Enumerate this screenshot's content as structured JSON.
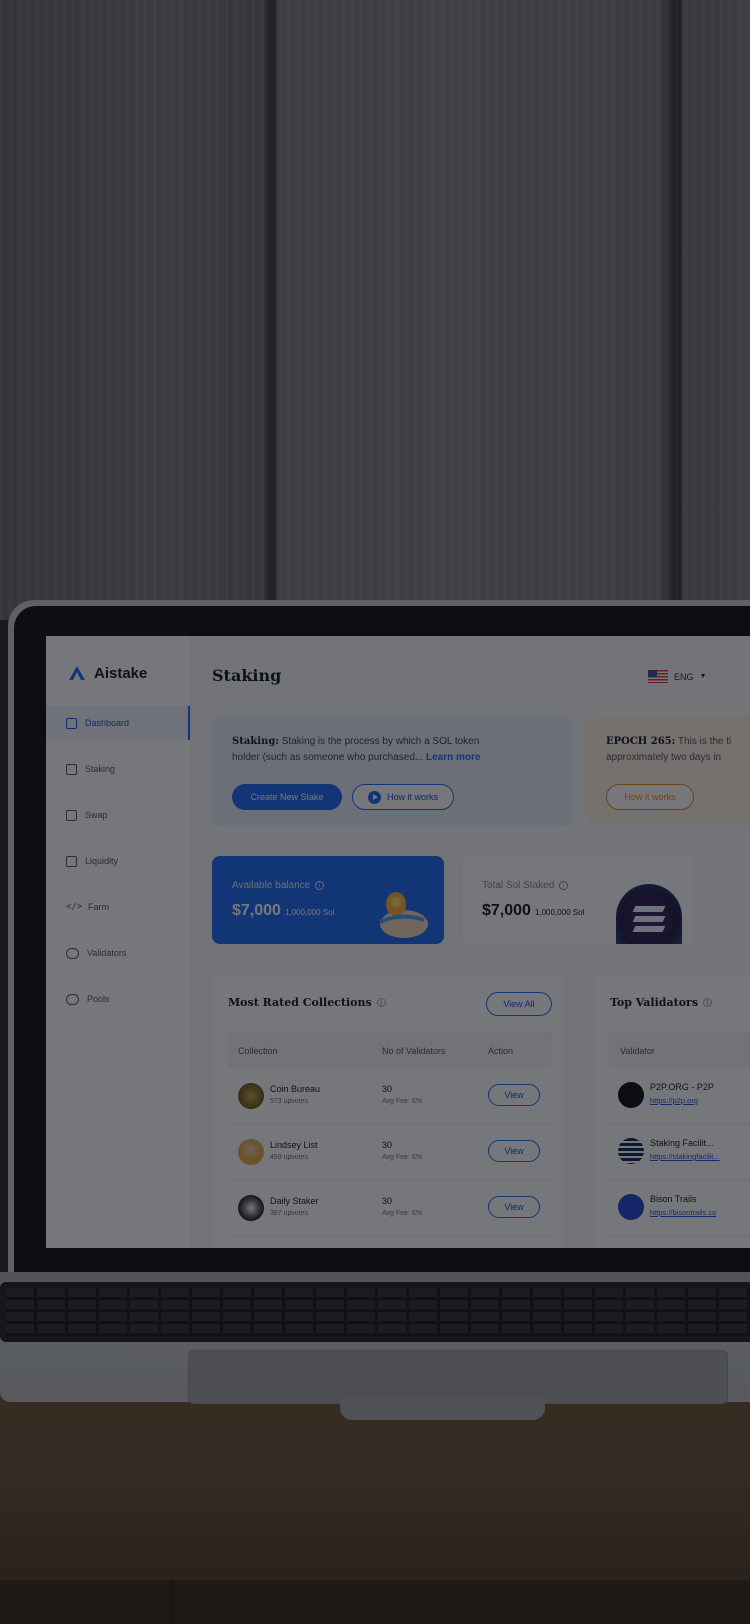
{
  "app": {
    "name": "Aistake"
  },
  "sidebar": {
    "items": [
      {
        "label": "Dashboard",
        "icon": "dashboard-icon",
        "active": true
      },
      {
        "label": "Staking",
        "icon": "staking-icon"
      },
      {
        "label": "Swap",
        "icon": "swap-icon"
      },
      {
        "label": "Liquidity",
        "icon": "card-icon"
      },
      {
        "label": "Farm",
        "icon": "code-icon"
      },
      {
        "label": "Validators",
        "icon": "validators-icon"
      },
      {
        "label": "Pools",
        "icon": "pools-icon"
      }
    ]
  },
  "header": {
    "title": "Staking",
    "language": "ENG"
  },
  "banner": {
    "lead": "Staking:",
    "text": "Staking is the process by which a SOL token holder (such as someone who purchased...",
    "link": "Learn more",
    "primary_button": "Create New Stake",
    "secondary_button": "How it works"
  },
  "epoch": {
    "lead": "EPOCH 265:",
    "line1": "This is the ti",
    "line2": "approximately two days in",
    "button": "How it works"
  },
  "cards": {
    "available": {
      "label": "Available balance",
      "value": "$7,000",
      "sub": "1,000,000 Sol"
    },
    "staked": {
      "label": "Total Sol Staked",
      "value": "$7,000",
      "sub": "1,000,000 Sol"
    }
  },
  "collections": {
    "title": "Most Rated Collections",
    "view_all": "View All",
    "columns": [
      "Collection",
      "No of Validators",
      "Action"
    ],
    "rows": [
      {
        "name": "Coin Bureau",
        "upvotes": "573 upvotes",
        "validators": "30",
        "fee": "Avg Fee: 6%",
        "action": "View"
      },
      {
        "name": "Lindsey List",
        "upvotes": "459 upvotes",
        "validators": "30",
        "fee": "Avg Fee: 6%",
        "action": "View"
      },
      {
        "name": "Daily Staker",
        "upvotes": "387 upvotes",
        "validators": "30",
        "fee": "Avg Fee: 6%",
        "action": "View"
      }
    ]
  },
  "validators": {
    "title": "Top Validators",
    "column": "Validator",
    "rows": [
      {
        "name": "P2P.ORG - P2P",
        "url": "https://p2p.org"
      },
      {
        "name": "Staking Facilit...",
        "url": "https://stakingfacilit..."
      },
      {
        "name": "Bison Trails",
        "url": "https://bisontrails.co"
      }
    ]
  },
  "colors": {
    "accent": "#1d6bf3",
    "orange": "#f08a24",
    "overlay": "rgba(10,12,18,0.56)"
  }
}
